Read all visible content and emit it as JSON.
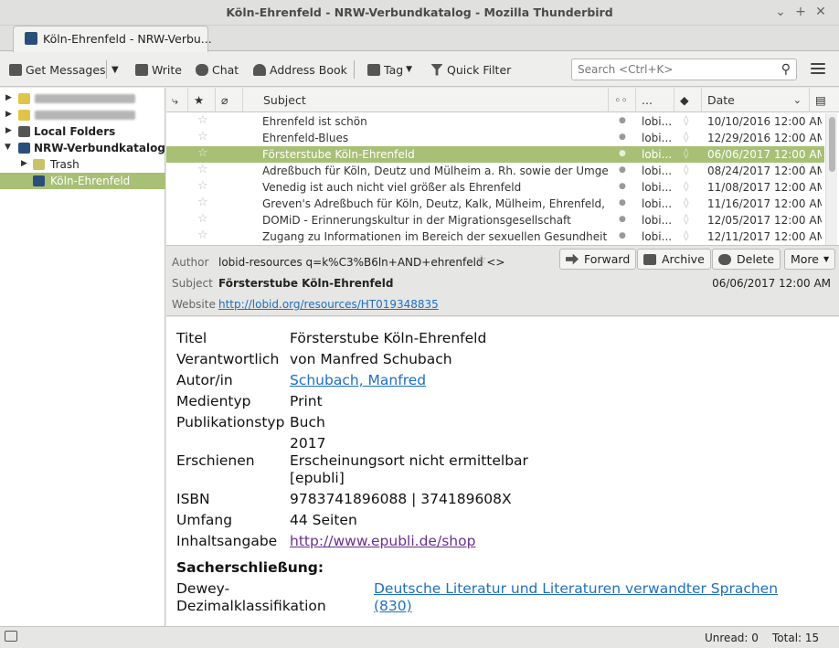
{
  "window": {
    "title": "Köln-Ehrenfeld - NRW-Verbundkatalog - Mozilla Thunderbird",
    "minimize": "⌄",
    "maximize": "+",
    "close": "✕"
  },
  "tab": {
    "label": "Köln-Ehrenfeld - NRW-Verbu..."
  },
  "toolbar": {
    "get_messages": "Get Messages",
    "write": "Write",
    "chat": "Chat",
    "address_book": "Address Book",
    "tag": "Tag",
    "quick_filter": "Quick Filter",
    "search_placeholder": "Search <Ctrl+K>"
  },
  "folders": {
    "local_folders": "Local Folders",
    "nrw": "NRW-Verbundkatalog",
    "trash": "Trash",
    "koeln": "Köln-Ehrenfeld"
  },
  "list": {
    "columns": {
      "subject": "Subject",
      "correspondents": "...",
      "date": "Date"
    },
    "rows": [
      {
        "subject": "Ehrenfeld ist schön",
        "from": "lobi...",
        "date": "10/10/2016 12:00 AM"
      },
      {
        "subject": "Ehrenfeld-Blues",
        "from": "lobi...",
        "date": "12/29/2016 12:00 AM"
      },
      {
        "subject": "Försterstube Köln-Ehrenfeld",
        "from": "lobi...",
        "date": "06/06/2017 12:00 AM"
      },
      {
        "subject": "Adreßbuch für Köln, Deutz und Mülheim a. Rh. sowie der Umgebu...",
        "from": "lobi...",
        "date": "08/24/2017 12:00 AM"
      },
      {
        "subject": "Venedig ist auch nicht viel größer als Ehrenfeld",
        "from": "lobi...",
        "date": "11/08/2017 12:00 AM"
      },
      {
        "subject": "Greven's Adreßbuch für Köln, Deutz, Kalk, Mülheim, Ehrenfeld, Ni...",
        "from": "lobi...",
        "date": "11/16/2017 12:00 AM"
      },
      {
        "subject": "DOMiD - Erinnerungskultur in der Migrationsgesellschaft",
        "from": "lobi...",
        "date": "12/05/2017 12:00 AM"
      },
      {
        "subject": "Zugang zu Informationen im Bereich der sexuellen Gesundheit al...",
        "from": "lobi...",
        "date": "12/11/2017 12:00 AM"
      }
    ]
  },
  "header": {
    "author_label": "Author",
    "author_value": "lobid-resources q=k%C3%B6ln+AND+ehrenfeld <>",
    "subject_label": "Subject",
    "subject_value": "Försterstube Köln-Ehrenfeld",
    "website_label": "Website",
    "website_value": "http://lobid.org/resources/HT019348835",
    "date": "06/06/2017 12:00 AM",
    "forward": "Forward",
    "archive": "Archive",
    "delete": "Delete",
    "more": "More"
  },
  "body": {
    "titel_l": "Titel",
    "titel_v": "Försterstube Köln-Ehrenfeld",
    "verant_l": "Verantwortlich",
    "verant_v": "von Manfred Schubach",
    "autor_l": "Autor/in",
    "autor_v": "Schubach, Manfred",
    "medien_l": "Medientyp",
    "medien_v": "Print",
    "pubtyp_l": "Publikationstyp",
    "pubtyp_v": "Buch",
    "ersch_l": "Erschienen",
    "ersch_v1": "2017",
    "ersch_v2": "Erscheinungsort nicht ermittelbar",
    "ersch_v3": "[epubli]",
    "isbn_l": "ISBN",
    "isbn_v": "9783741896088 | 374189608X",
    "umfang_l": "Umfang",
    "umfang_v": "44 Seiten",
    "inhalt_l": "Inhaltsangabe",
    "inhalt_v": "http://www.epubli.de/shop",
    "sacher": "Sacherschließung:",
    "dewey_l1": "Dewey-",
    "dewey_l2": "Dezimalklassifikation",
    "dewey_v1": "Deutsche Literatur und Literaturen verwandter Sprachen",
    "dewey_v2": "(830)"
  },
  "status": {
    "unread": "Unread: 0",
    "total": "Total: 15"
  }
}
